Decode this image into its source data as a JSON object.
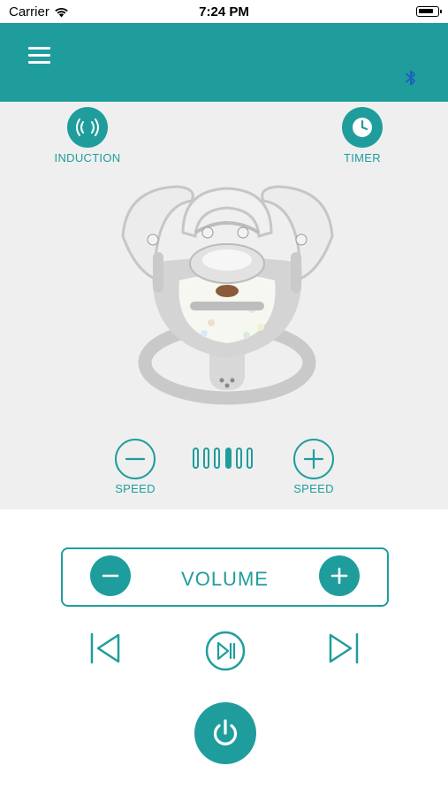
{
  "status_bar": {
    "carrier": "Carrier",
    "time": "7:24 PM",
    "battery_level": 0.75
  },
  "header": {
    "menu_icon": "hamburger-menu-icon",
    "bluetooth_icon": "bluetooth-icon"
  },
  "controls": {
    "induction_label": "INDUCTION",
    "timer_label": "TIMER",
    "speed_decrease_label": "SPEED",
    "speed_increase_label": "SPEED",
    "speed_level": 4,
    "speed_levels_total": 6
  },
  "product": {
    "image_icon": "baby-swing-image"
  },
  "volume": {
    "label": "VOLUME"
  },
  "playback": {
    "prev_icon": "skip-previous-icon",
    "play_pause_icon": "play-pause-icon",
    "next_icon": "skip-next-icon"
  },
  "power": {
    "icon": "power-icon"
  },
  "colors": {
    "accent": "#1f9d9d",
    "panel_bg": "#efefef",
    "white": "#ffffff"
  }
}
